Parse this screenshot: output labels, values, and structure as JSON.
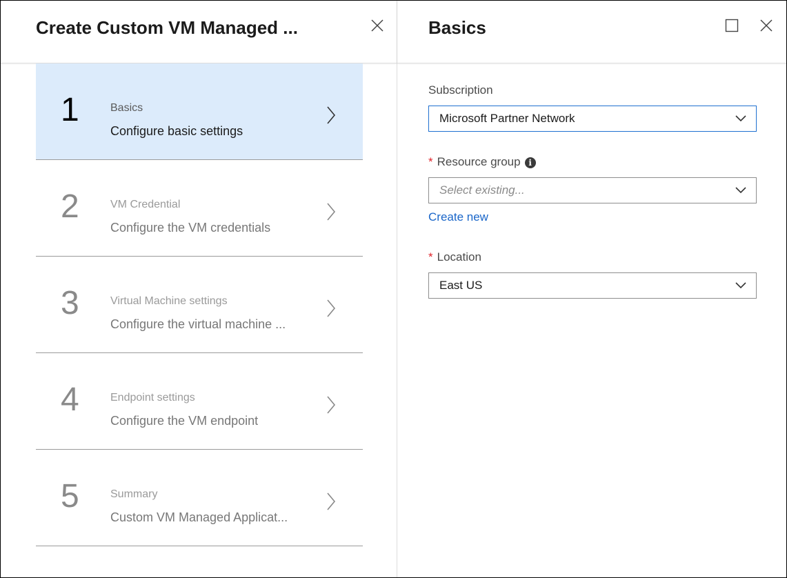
{
  "left_blade": {
    "title": "Create Custom VM Managed ...",
    "steps": [
      {
        "number": "1",
        "title": "Basics",
        "description": "Configure basic settings",
        "active": true
      },
      {
        "number": "2",
        "title": "VM Credential",
        "description": "Configure the VM credentials",
        "active": false
      },
      {
        "number": "3",
        "title": "Virtual Machine settings",
        "description": "Configure the virtual machine ...",
        "active": false
      },
      {
        "number": "4",
        "title": "Endpoint settings",
        "description": "Configure the VM endpoint",
        "active": false
      },
      {
        "number": "5",
        "title": "Summary",
        "description": "Custom VM Managed Applicat...",
        "active": false
      }
    ]
  },
  "right_blade": {
    "title": "Basics",
    "subscription": {
      "label": "Subscription",
      "value": "Microsoft Partner Network"
    },
    "resource_group": {
      "required_mark": "*",
      "label": "Resource group",
      "placeholder": "Select existing...",
      "create_new": "Create new"
    },
    "location": {
      "required_mark": "*",
      "label": "Location",
      "value": "East US"
    }
  },
  "colors": {
    "accent": "#1a66c9",
    "active_step_bg": "#dcebfb",
    "required": "#e0242b"
  }
}
